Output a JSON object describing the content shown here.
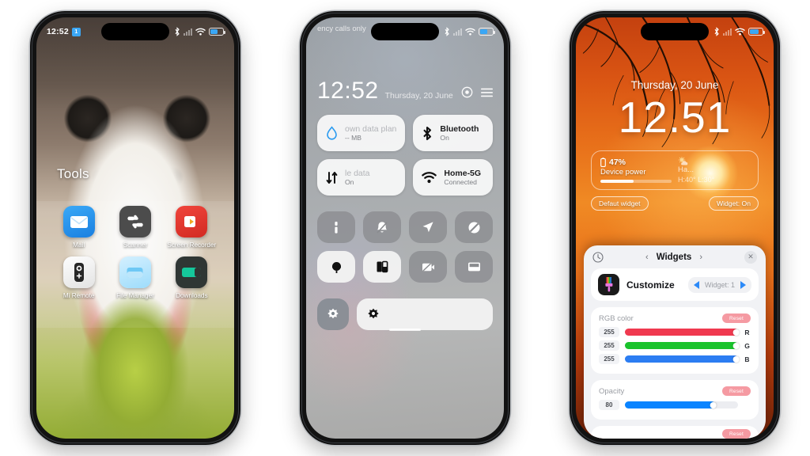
{
  "meta": {
    "background_color": "#ffffff",
    "phone_count": 3
  },
  "phone1": {
    "name": "home-screen",
    "status_bar": {
      "time": "12:52",
      "badge": "1",
      "icons": [
        "bluetooth-icon",
        "signal-icon",
        "wifi-icon",
        "battery-icon"
      ]
    },
    "folder": {
      "title": "Tools"
    },
    "apps": [
      {
        "label": "Mail",
        "icon": "mail-icon"
      },
      {
        "label": "Scanner",
        "icon": "scanner-icon"
      },
      {
        "label": "Screen Recorder",
        "icon": "screen-recorder-icon"
      },
      {
        "label": "Mi Remote",
        "icon": "remote-icon"
      },
      {
        "label": "File Manager",
        "icon": "file-manager-icon"
      },
      {
        "label": "Downloads",
        "icon": "downloads-icon"
      }
    ]
  },
  "phone2": {
    "name": "control-center",
    "carrier": "ency calls only",
    "status_bar": {
      "icons": [
        "bluetooth-icon",
        "signal-icon",
        "wifi-icon",
        "battery-icon"
      ]
    },
    "clock": {
      "time": "12:52",
      "date": "Thursday, 20 June"
    },
    "header_icons": [
      {
        "name": "settings-gear-icon"
      },
      {
        "name": "menu-icon"
      }
    ],
    "big_tiles": [
      {
        "title": "own data plan",
        "subtitle": "-- MB",
        "icon": "water-drop-icon",
        "state": "dim"
      },
      {
        "title": "Bluetooth",
        "subtitle": "On",
        "icon": "bluetooth-icon",
        "state": "active"
      },
      {
        "title": "le data",
        "subtitle": "On",
        "icon": "mobile-data-icon",
        "state": "dim"
      },
      {
        "title": "Home-5G",
        "subtitle": "Connected",
        "icon": "wifi-icon",
        "state": "active"
      }
    ],
    "small_tiles": [
      {
        "icon": "flashlight-icon",
        "state": "off"
      },
      {
        "icon": "silent-bell-icon",
        "state": "off"
      },
      {
        "icon": "location-icon",
        "state": "off"
      },
      {
        "icon": "dnd-icon",
        "state": "off"
      },
      {
        "icon": "dark-mode-icon",
        "state": "on"
      },
      {
        "icon": "reading-mode-icon",
        "state": "on"
      },
      {
        "icon": "screenshot-icon",
        "state": "off"
      },
      {
        "icon": "screen-cast-icon",
        "state": "off"
      }
    ],
    "last_row": {
      "tile": {
        "icon": "brightness-icon",
        "state": "mid"
      },
      "slider": {
        "icon": "brightness-icon",
        "label": "brightness-slider"
      }
    }
  },
  "phone3": {
    "name": "lock-screen-widgets",
    "status_bar": {
      "icons": [
        "bluetooth-icon",
        "signal-icon",
        "wifi-icon",
        "battery-icon"
      ]
    },
    "lock": {
      "date": "Thursday, 20 June",
      "time": "12.51",
      "widget": {
        "battery_percent": "47%",
        "battery_label": "Device power",
        "battery_fill": 47,
        "weather_title": "Ha...",
        "weather_sub": "H:40° L:30°",
        "battery_icon": "battery-vertical-icon",
        "weather_icon": "sun-cloud-icon"
      },
      "chips": [
        {
          "label": "Defaut widget"
        },
        {
          "label": "Widget: On"
        }
      ]
    },
    "panel": {
      "title": "Widgets",
      "history_icon": "history-clock-icon",
      "prev_arrow": "chevron-left-icon",
      "next_arrow": "chevron-right-icon",
      "close_icon": "close-icon",
      "customize": {
        "label": "Customize",
        "icon": "paint-brush-icon",
        "stepper_label": "Widget: 1",
        "prev_icon": "triangle-left-icon",
        "next_icon": "triangle-right-icon"
      },
      "rgb": {
        "title": "RGB color",
        "reset_label": "Reset",
        "channels": [
          {
            "value": "255",
            "channel": "R",
            "color": "#f0394f",
            "percent": 100
          },
          {
            "value": "255",
            "channel": "G",
            "color": "#19c32c",
            "percent": 100
          },
          {
            "value": "255",
            "channel": "B",
            "color": "#2c7df2",
            "percent": 100
          }
        ]
      },
      "opacity": {
        "title": "Opacity",
        "reset_label": "Reset",
        "value": "80",
        "percent": 80,
        "color": "#0a84ff"
      },
      "peek_card": {
        "reset_label": "Reset"
      }
    }
  }
}
